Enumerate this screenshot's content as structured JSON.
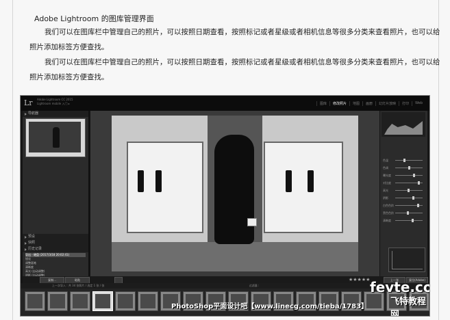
{
  "article": {
    "title": "Adobe Lightroom 的图库管理界面",
    "paragraph1": "我们可以在图库栏中管理自己的照片，可以按照日期查看，按照标记或者星级或者相机信息等很多分类来查看照片，也可以给照片添加标签方便查找。",
    "paragraph2": "我们可以在图库栏中管理自己的照片，可以按照日期查看，按照标记或者星级或者相机信息等很多分类来查看照片，也可以给照片添加标签方便查找。"
  },
  "lightroom": {
    "logo": "Lr",
    "identity": "Adobe Lightroom CC 2015\nLightroom mobile 入门 ▸",
    "modules": [
      "图库",
      "修改照片",
      "地图",
      "画册",
      "幻灯片放映",
      "打印",
      "Web"
    ],
    "active_module": "修改照片",
    "left_panels": {
      "navigator": "导航器",
      "presets": "预设",
      "snapshots": "快照",
      "history": "历史记录",
      "collections": "收藏夹"
    },
    "history_items": [
      "导出 - 硬盘 (2017/3/18 20:02:41)",
      "锐化",
      "调整画笔",
      "清晰度",
      "高光 (自动调整)",
      "阴影 (自动调整)",
      "白色色阶",
      "对比度",
      "曝光度",
      "黑色色阶",
      "色调曲线",
      "径向滤镜",
      "设置黑白",
      "色温 (自动调整)",
      "导入 (2017/3/18)"
    ],
    "right_panel": {
      "histogram": "直方图",
      "basic": "基本",
      "treatment": "处理方式",
      "treatment_value": "黑白",
      "sliders": [
        "色温",
        "色调",
        "曝光度",
        "对比度",
        "高光",
        "阴影",
        "白色色阶",
        "黑色色阶",
        "清晰度"
      ],
      "tone_curve": "色调曲线"
    },
    "toolbar": {
      "copy": "复制...",
      "paste": "粘贴",
      "previous": "上一张",
      "reset": "复位(Adobe)",
      "soft_proof": "软打样"
    },
    "filmstrip_info": "上一次导入 : 共 34 张照片 / 选定 1 张 / 张",
    "filter_label": "过滤器 :",
    "watermark": "PhotoShop平面设计吧【www.linecg.com/tieba/1783】",
    "logo_mark": "fevte.com",
    "logo_sub": "飞特教程网"
  }
}
